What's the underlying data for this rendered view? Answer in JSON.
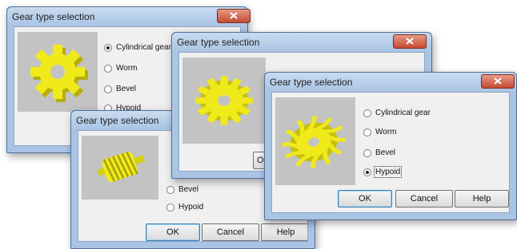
{
  "title": "Gear type selection",
  "options": {
    "cylindrical": "Cylindrical gear",
    "worm": "Worm",
    "bevel": "Bevel",
    "hypoid": "Hypoid"
  },
  "buttons": {
    "ok": "OK",
    "cancel": "Cancel",
    "help": "Help"
  },
  "dialogs": [
    {
      "id": "cylindrical",
      "selected": "Cylindrical gear",
      "preview": "spur-gear"
    },
    {
      "id": "worm",
      "preview": "worm-gear"
    },
    {
      "id": "bevel",
      "preview": "bevel-gear"
    },
    {
      "id": "hypoid",
      "selected": "Hypoid",
      "preview": "hypoid-gear"
    }
  ],
  "colors": {
    "gear": "#f0ea1b",
    "title_bg": "#a9c4e4",
    "close": "#c54b31",
    "preview_bg": "#c3c3c3"
  }
}
